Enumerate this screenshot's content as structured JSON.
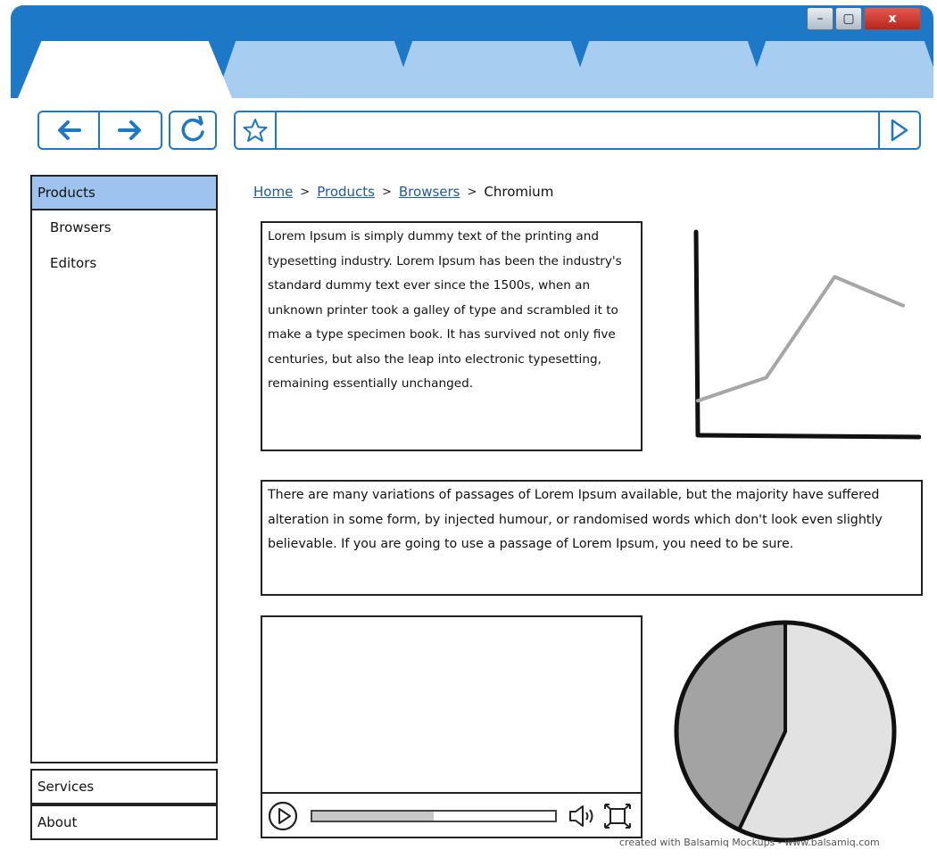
{
  "window": {
    "controls": {
      "minimize": "–",
      "maximize": "▢",
      "close": "x"
    }
  },
  "address_bar": {
    "url": ""
  },
  "sidebar": {
    "sections": [
      {
        "label": "Products",
        "expanded": true,
        "items": [
          "Browsers",
          "Editors"
        ]
      },
      {
        "label": "Services",
        "expanded": false
      },
      {
        "label": "About",
        "expanded": false
      }
    ]
  },
  "breadcrumb": {
    "links": [
      "Home",
      "Products",
      "Browsers"
    ],
    "current": "Chromium",
    "separator": ">"
  },
  "text_blocks": [
    "Lorem Ipsum is simply dummy text of the printing and typesetting industry. Lorem Ipsum has been the industry's standard dummy text ever since the 1500s, when an unknown printer took a galley of type and scrambled it to make a type specimen book. It has survived not only five centuries, but also the leap into electronic typesetting, remaining essentially unchanged.",
    "There are many variations of passages of Lorem Ipsum available, but the majority have suffered alteration in some form, by injected humour, or randomised words which don't look even slightly believable. If you are going to use a passage of Lorem Ipsum, you need to be sure."
  ],
  "video_player": {
    "progress": 0.5,
    "icons": [
      "play-icon",
      "volume-icon",
      "fullscreen-icon"
    ]
  },
  "chart_data": [
    {
      "type": "line",
      "title": "",
      "xlabel": "",
      "ylabel": "",
      "x": [
        0,
        1,
        2,
        3
      ],
      "y": [
        1.2,
        2.0,
        5.5,
        4.5
      ],
      "ylim": [
        0,
        7
      ],
      "series_color": "#a6a6a6"
    },
    {
      "type": "pie",
      "title": "",
      "values": [
        57,
        43
      ],
      "colors": [
        "#e2e2e2",
        "#a3a3a3"
      ],
      "start_angle_deg": 0
    }
  ],
  "footer": {
    "credit": "created with Balsamiq Mockups - www.balsamiq.com"
  },
  "colors": {
    "chrome_blue": "#1e78c8",
    "inactive_tab": "#a7cdf0",
    "selected_header": "#9ec3ee",
    "link": "#1f5aa6"
  }
}
